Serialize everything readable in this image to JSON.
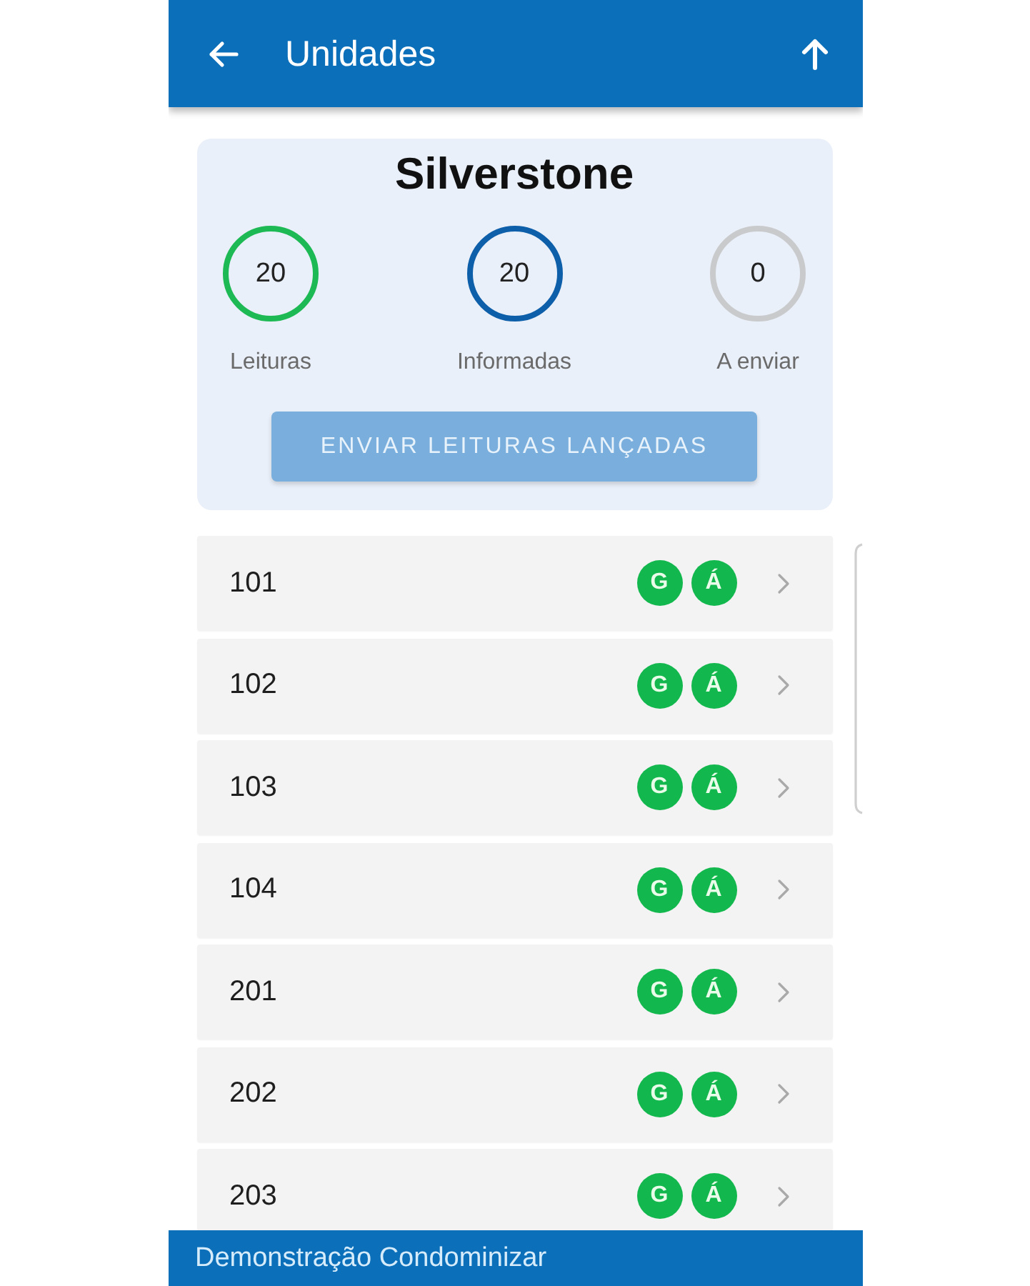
{
  "header": {
    "title": "Unidades"
  },
  "summary": {
    "title": "Silverstone",
    "stats": [
      {
        "value": "20",
        "label": "Leituras",
        "color": "#1db954"
      },
      {
        "value": "20",
        "label": "Informadas",
        "color": "#0e5fa9"
      },
      {
        "value": "0",
        "label": "A enviar",
        "color": "#c9cacc"
      }
    ],
    "button": {
      "label": "ENVIAR LEITURAS LANÇADAS",
      "disabled": true
    }
  },
  "units": [
    {
      "name": "101",
      "badges": [
        {
          "letter": "G",
          "done": true
        },
        {
          "letter": "Á",
          "done": true
        }
      ]
    },
    {
      "name": "102",
      "badges": [
        {
          "letter": "G",
          "done": true
        },
        {
          "letter": "Á",
          "done": true
        }
      ]
    },
    {
      "name": "103",
      "badges": [
        {
          "letter": "G",
          "done": true
        },
        {
          "letter": "Á",
          "done": true
        }
      ]
    },
    {
      "name": "104",
      "badges": [
        {
          "letter": "G",
          "done": true
        },
        {
          "letter": "Á",
          "done": true
        }
      ]
    },
    {
      "name": "201",
      "badges": [
        {
          "letter": "G",
          "done": true
        },
        {
          "letter": "Á",
          "done": true
        }
      ]
    },
    {
      "name": "202",
      "badges": [
        {
          "letter": "G",
          "done": true
        },
        {
          "letter": "Á",
          "done": true
        }
      ]
    },
    {
      "name": "203",
      "badges": [
        {
          "letter": "G",
          "done": true
        },
        {
          "letter": "Á",
          "done": true
        }
      ]
    }
  ],
  "footer": {
    "text": "Demonstração Condominizar"
  }
}
